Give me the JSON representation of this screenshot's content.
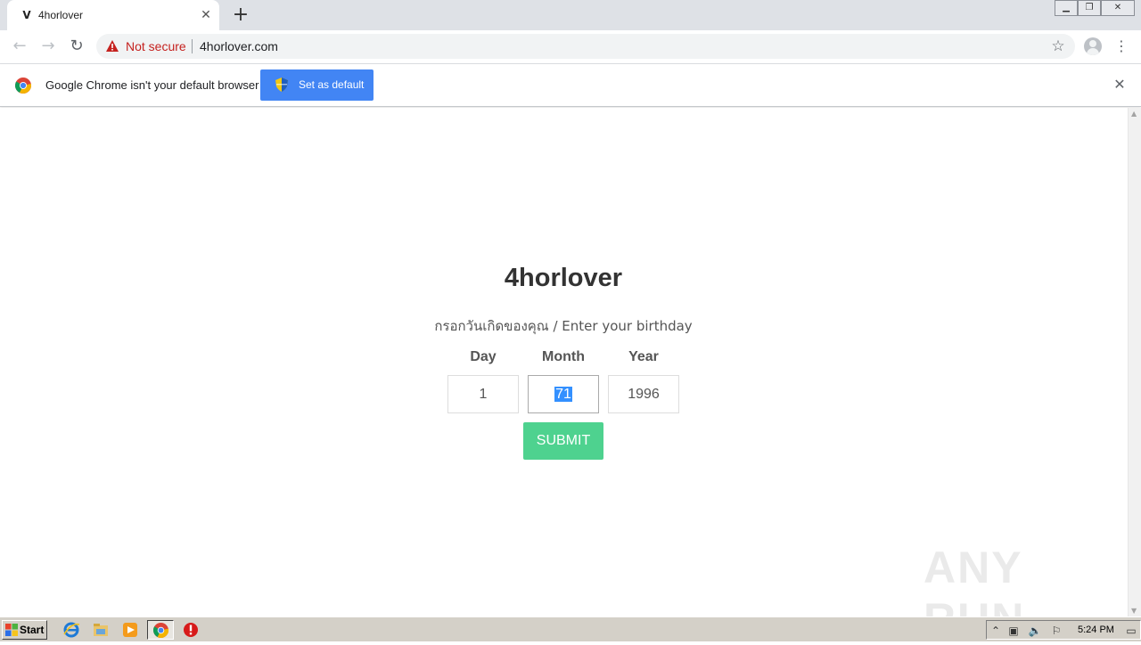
{
  "browser": {
    "tab": {
      "title": "4horlover",
      "favicon": "4horlover-favicon"
    },
    "address": {
      "security_label": "Not secure",
      "url": "4horlover.com"
    },
    "infobar": {
      "message": "Google Chrome isn't your default browser",
      "button_label": "Set as default"
    }
  },
  "page": {
    "title": "4horlover",
    "subtitle": "กรอกวันเกิดของคุณ / Enter your birthday",
    "fields": [
      {
        "label": "Day",
        "value": "1"
      },
      {
        "label": "Month",
        "value": "71"
      },
      {
        "label": "Year",
        "value": "1996"
      }
    ],
    "submit_label": "SUBMIT"
  },
  "watermark": {
    "text": "ANY RUN"
  },
  "taskbar": {
    "start_label": "Start",
    "clock": "5:24 PM"
  },
  "colors": {
    "accent": "#4285f4",
    "submit": "#4ed28f",
    "warning": "#c5221f"
  }
}
